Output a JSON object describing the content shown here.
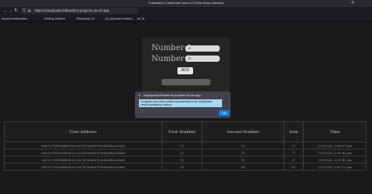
{
  "browser": {
    "tab_title": "Transaction Confirmed! View on Public Scan: Network",
    "url": "https://simplyadd-sidharthns-projects.vercel.app",
    "close": "✕"
  },
  "bookmarks": [
    {
      "label": "Import bookmarks..."
    },
    {
      "label": "Getting Started"
    },
    {
      "label": "Storybook UI"
    },
    {
      "label": "(1) imported motion"
    },
    {
      "label": "dc UI"
    }
  ],
  "form": {
    "number1_label": "Number 1:",
    "number1_value": "12",
    "number2_label": "Number 2:",
    "number2_value": "15",
    "add_label": "ADD"
  },
  "dialog": {
    "title": "simplyadd-sidharthns-projects.vercel.app",
    "message": "Congrats! you have written successfully to the blockchain, check transaction history",
    "ok_label": "OK"
  },
  "table": {
    "headers": [
      "User Address",
      "First Number",
      "Second Number",
      "Sum",
      "Time"
    ],
    "rows": [
      [
        "0xE1e71EDd6fb5b9c5cA7439d66F958d6d4b3a5bd8",
        "12",
        "15",
        "27",
        "1/9/2024, 3:08:07 pm"
      ],
      [
        "0xE1e71EDd6fb5b9c5cA7439d66F958d6d4b3a5bd8",
        "12",
        "15",
        "27",
        "1/9/2024, 5:16:46 pm"
      ],
      [
        "0xE1e71EDd6fb5b9c5cA7439d66F958d6d4b3a5bd8",
        "12",
        "15",
        "27",
        "1/9/2024, 5:21:40 pm"
      ],
      [
        "0xE1e71EDd6fb5b9c5cA7439d66F958d6d4b3a5bd8",
        "35",
        "46",
        "81",
        "1/9/2024, 5:41:13 pm"
      ]
    ]
  }
}
